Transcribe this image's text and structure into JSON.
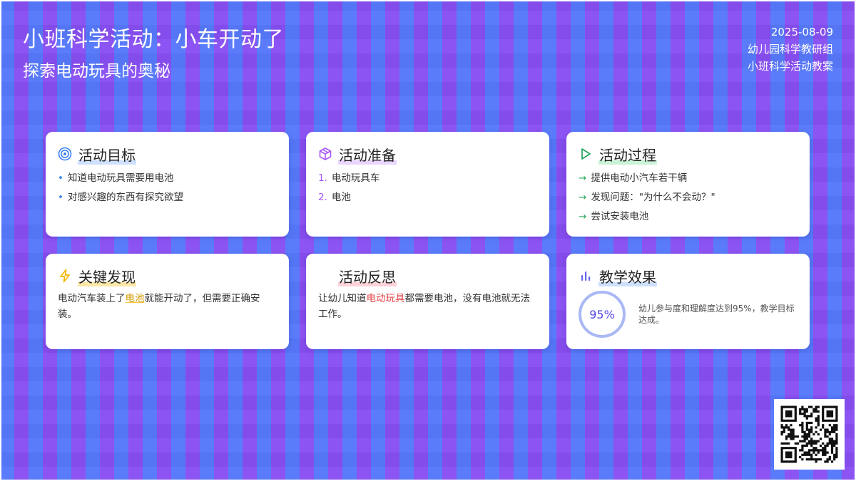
{
  "header": {
    "title": "小班科学活动：小车开动了",
    "subtitle": "探索电动玩具的奥秘",
    "date": "2025-08-09",
    "org": "幼儿园科学教研组",
    "doc_type": "小班科学活动教案"
  },
  "cards": {
    "goals": {
      "icon": "target-icon",
      "title": "活动目标",
      "items": [
        "知道电动玩具需要用电池",
        "对感兴趣的东西有探究欲望"
      ]
    },
    "prep": {
      "icon": "box-icon",
      "title": "活动准备",
      "items": [
        {
          "num": "1.",
          "text": "电动玩具车"
        },
        {
          "num": "2.",
          "text": "电池"
        }
      ]
    },
    "process": {
      "icon": "play-icon",
      "title": "活动过程",
      "items": [
        "提供电动小汽车若干辆",
        "发现问题：\"为什么不会动？\"",
        "尝试安装电池"
      ]
    },
    "findings": {
      "icon": "lightning-icon",
      "title": "关键发现",
      "text_before": "电动汽车装上了",
      "highlight": "电池",
      "text_after": "就能开动了，但需要正确安装。"
    },
    "reflection": {
      "title": "活动反思",
      "text_before": "让幼儿知道",
      "highlight": "电动玩具",
      "text_after": "都需要电池，没有电池就无法工作。"
    },
    "effect": {
      "icon": "bar-chart-icon",
      "title": "教学效果",
      "percent_label": "95%",
      "percent_value": 0.95,
      "description": "幼儿参与度和理解度达到95%，教学目标达成。"
    }
  },
  "colors": {
    "blue": "#3b82f6",
    "purple": "#a855f7",
    "green": "#22a45a",
    "yellow": "#f5b400",
    "red": "#e5484d",
    "indigo": "#4f46e5"
  }
}
